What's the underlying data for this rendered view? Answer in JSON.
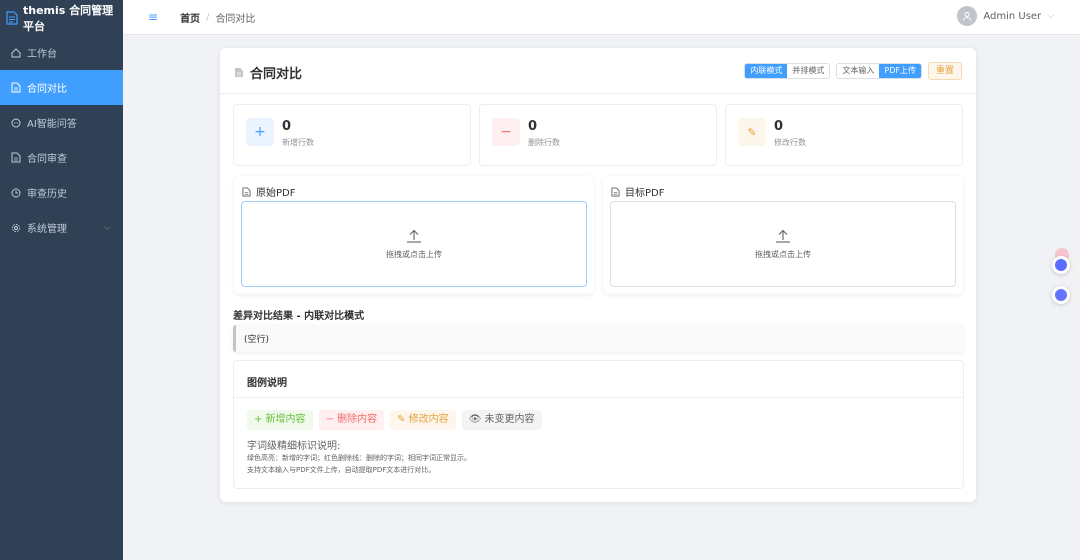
{
  "app": {
    "brand": "themis 合同管理平台"
  },
  "sidebar": {
    "items": [
      {
        "label": "工作台",
        "icon": "home-icon"
      },
      {
        "label": "合同对比",
        "icon": "document-icon",
        "active": true
      },
      {
        "label": "AI智能问答",
        "icon": "chat-icon"
      },
      {
        "label": "合同审查",
        "icon": "document-icon"
      },
      {
        "label": "审查历史",
        "icon": "clock-icon"
      },
      {
        "label": "系统管理",
        "icon": "gear-icon",
        "expandable": true
      }
    ]
  },
  "header": {
    "breadcrumb": {
      "home": "首页",
      "separator": "/",
      "current": "合同对比"
    },
    "user": "Admin User"
  },
  "page": {
    "title": "合同对比",
    "view_modes": [
      "内联模式",
      "并排模式"
    ],
    "input_modes": [
      "文本输入",
      "PDF上传"
    ],
    "reset": "重置"
  },
  "stats": [
    {
      "value": "0",
      "label": "新增行数",
      "icon": "+",
      "color": "#409eff",
      "bg": "#ecf5ff"
    },
    {
      "value": "0",
      "label": "删除行数",
      "icon": "−",
      "color": "#f56c6c",
      "bg": "#fef0f0"
    },
    {
      "value": "0",
      "label": "修改行数",
      "icon": "✎",
      "color": "#e6a23c",
      "bg": "#fdf6ec"
    }
  ],
  "upload": {
    "source": {
      "title": "原始PDF",
      "hint": "拖拽或点击上传"
    },
    "target": {
      "title": "目标PDF",
      "hint": "拖拽或点击上传"
    }
  },
  "result": {
    "title": "差异对比结果 - 内联对比模式",
    "content": "(空行)"
  },
  "legend": {
    "title": "图例说明",
    "tags": [
      {
        "label": "+ 新增内容",
        "kind": "add"
      },
      {
        "label": "− 删除内容",
        "kind": "del"
      },
      {
        "label": "✎ 修改内容",
        "kind": "mod"
      },
      {
        "label": "👁 未变更内容",
        "kind": "same"
      }
    ],
    "note_heading": "字词级精细标识说明:",
    "notes": [
      "绿色高亮：新增的字词；红色删除线：删除的字词；相同字词正常显示。",
      "支持文本输入与PDF文件上传，自动提取PDF文本进行对比。"
    ]
  },
  "colors": {
    "sidebar": "#304156",
    "primary": "#409eff",
    "warning": "#e6a23c"
  }
}
